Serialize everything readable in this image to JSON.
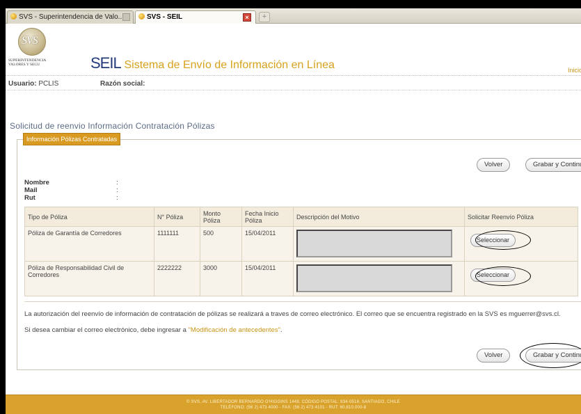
{
  "browser": {
    "tabs": [
      {
        "label": "SVS - Superintendencia de Valo..."
      },
      {
        "label": "SVS - SEIL"
      }
    ],
    "new_tab_glyph": "+"
  },
  "header": {
    "logo_text": "SVS",
    "logo_sub_line1": "SUPERINTENDENCIA",
    "logo_sub_line2": "VALORES Y SEGU",
    "acronym": "SEIL",
    "full_name": "Sistema de Envío de Información en Línea",
    "inicio_link": "Inicio S"
  },
  "userbar": {
    "usuario_label": "Usuario:",
    "usuario_value": "PCLIS",
    "razon_label": "Razón social:",
    "razon_value": ""
  },
  "page_heading": "Solicitud de reenvio Información Contratación Pólizas",
  "panel": {
    "legend": "Información Pólizas Contratadas",
    "buttons": {
      "volver": "Volver",
      "grabar": "Grabar y Continuar"
    },
    "info": [
      {
        "label": "Nombre",
        "colon": ":"
      },
      {
        "label": "Mail",
        "colon": ":"
      },
      {
        "label": "Rut",
        "colon": ":"
      }
    ],
    "table": {
      "headers": [
        "Tipo de Póliza",
        "N° Póliza",
        "Monto Póliza",
        "Fecha Inicio Póliza",
        "Descripción del Motivo",
        "Solicitar Reenvío Póliza"
      ],
      "rows": [
        {
          "tipo": "Póliza de Garantía de Corredores",
          "numero": "1111111",
          "monto": "500",
          "fecha": "15/04/2011",
          "accion": "Seleccionar"
        },
        {
          "tipo": "Póliza de Responsabilidad Civil de Corredores",
          "numero": "2222222",
          "monto": "3000",
          "fecha": "15/04/2011",
          "accion": "Seleccionar"
        }
      ]
    },
    "note_line1": "La autorización del reenvío de información de contratación de pólizas se realizará a traves de correo electrónico. El correo que se encuentra registrado en la SVS es mguerrer@svs.cl.",
    "note_line2_prefix": "Si desea cambiar el correo electrónico, debe ingresar a",
    "note_link": "\"Modificación de antecedentes\"",
    "note_line2_suffix": "."
  },
  "footer": {
    "line1": "© SVS, AV. LIBERTADOR BERNARDO O'HIGGINS 1449, CÓDIGO POSTAL: 834-0518, SANTIAGO, CHILE",
    "line2": "TELÉFONO: (56 2) 473 4000 - FAX: (56 2) 473 4101 - RUT: 60.810.000-8"
  },
  "colors": {
    "accent": "#d99a22",
    "title_blue": "#243b7a",
    "link_gold": "#c79416"
  }
}
